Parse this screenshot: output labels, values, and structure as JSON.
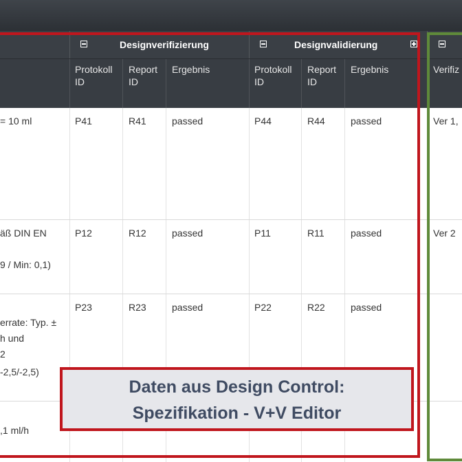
{
  "header": {
    "groups": [
      {
        "title": "Designverifizierung",
        "icon": "collapse-icon"
      },
      {
        "title": "Designvalidierung",
        "icon": "collapse-icon",
        "extra_icon": "expand-icon"
      }
    ],
    "columns": {
      "dv_protocol": "Protokoll\nID",
      "dv_report": "Report\nID",
      "dv_result": "Ergebnis",
      "val_protocol": "Protokoll\nID",
      "val_report": "Report\nID",
      "val_result": "Ergebnis",
      "verif": "Verifiz"
    }
  },
  "rows": [
    {
      "spec": [
        "= 10 ml"
      ],
      "dv_protocol": "P41",
      "dv_report": "R41",
      "dv_result": "passed",
      "val_protocol": "P44",
      "val_report": "R44",
      "val_result": "passed",
      "verif": "Ver 1,"
    },
    {
      "spec": [
        "äß DIN EN",
        "9 / Min: 0,1)"
      ],
      "dv_protocol": "P12",
      "dv_report": "R12",
      "dv_result": "passed",
      "val_protocol": "P11",
      "val_report": "R11",
      "val_result": "passed",
      "verif": "Ver 2"
    },
    {
      "spec": [
        "errate: Typ. ±",
        "h und",
        "2",
        "-2,5/-2,5)"
      ],
      "dv_protocol": "P23",
      "dv_report": "R23",
      "dv_result": "passed",
      "val_protocol": "P22",
      "val_report": "R22",
      "val_result": "passed",
      "verif": ""
    },
    {
      "spec": [
        ",1 ml/h"
      ],
      "dv_protocol": "",
      "dv_report": "",
      "dv_result": "",
      "val_protocol": "",
      "val_report": "",
      "val_result": "",
      "verif": ""
    }
  ],
  "overlay": {
    "line1": "Daten aus Design Control:",
    "line2": "Spezifikation - V+V Editor"
  },
  "colors": {
    "highlight_red": "#c0161d",
    "highlight_green": "#5f8a3a",
    "header_bg": "#383d43"
  }
}
